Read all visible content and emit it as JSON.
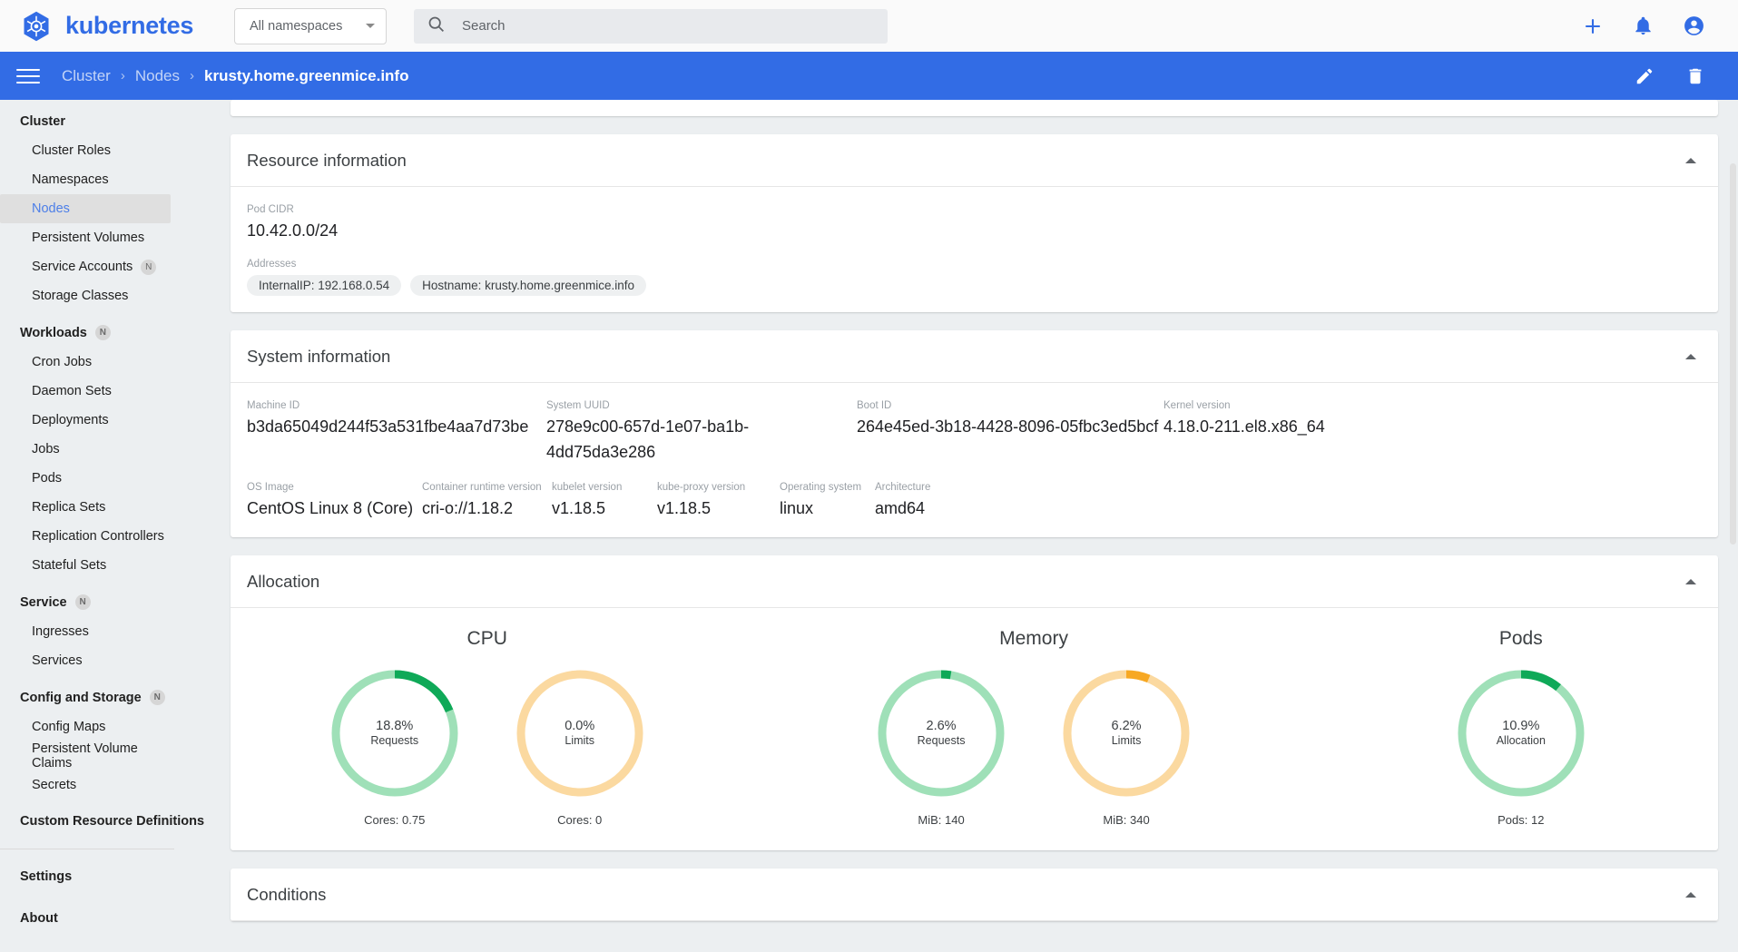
{
  "header": {
    "brand": "kubernetes",
    "logo_icon": "kubernetes-helm-logo",
    "namespace_selector": {
      "value": "All namespaces",
      "icon": "chevron-down-icon"
    },
    "search": {
      "placeholder": "Search",
      "value": "",
      "icon": "search-icon"
    },
    "actions": [
      {
        "name": "create-button",
        "icon": "plus-icon"
      },
      {
        "name": "notifications-button",
        "icon": "bell-icon"
      },
      {
        "name": "account-button",
        "icon": "account-circle-icon"
      }
    ]
  },
  "breadcrumb_bar": {
    "menu_icon": "hamburger-menu-icon",
    "crumbs": [
      {
        "label": "Cluster",
        "active": false
      },
      {
        "label": "Nodes",
        "active": false
      },
      {
        "label": "krusty.home.greenmice.info",
        "active": true
      }
    ],
    "separator": "›",
    "actions": [
      {
        "name": "edit-button",
        "icon": "pencil-icon"
      },
      {
        "name": "delete-button",
        "icon": "trash-icon"
      }
    ]
  },
  "sidebar": {
    "groups": [
      {
        "title": "Cluster",
        "badge": null,
        "items": [
          {
            "label": "Cluster Roles",
            "badge": null,
            "selected": false
          },
          {
            "label": "Namespaces",
            "badge": null,
            "selected": false
          },
          {
            "label": "Nodes",
            "badge": null,
            "selected": true
          },
          {
            "label": "Persistent Volumes",
            "badge": null,
            "selected": false
          },
          {
            "label": "Service Accounts",
            "badge": "N",
            "selected": false
          },
          {
            "label": "Storage Classes",
            "badge": null,
            "selected": false
          }
        ]
      },
      {
        "title": "Workloads",
        "badge": "N",
        "items": [
          {
            "label": "Cron Jobs",
            "badge": null,
            "selected": false
          },
          {
            "label": "Daemon Sets",
            "badge": null,
            "selected": false
          },
          {
            "label": "Deployments",
            "badge": null,
            "selected": false
          },
          {
            "label": "Jobs",
            "badge": null,
            "selected": false
          },
          {
            "label": "Pods",
            "badge": null,
            "selected": false
          },
          {
            "label": "Replica Sets",
            "badge": null,
            "selected": false
          },
          {
            "label": "Replication Controllers",
            "badge": null,
            "selected": false
          },
          {
            "label": "Stateful Sets",
            "badge": null,
            "selected": false
          }
        ]
      },
      {
        "title": "Service",
        "badge": "N",
        "items": [
          {
            "label": "Ingresses",
            "badge": null,
            "selected": false
          },
          {
            "label": "Services",
            "badge": null,
            "selected": false
          }
        ]
      },
      {
        "title": "Config and Storage",
        "badge": "N",
        "items": [
          {
            "label": "Config Maps",
            "badge": null,
            "selected": false
          },
          {
            "label": "Persistent Volume Claims",
            "badge": null,
            "selected": false
          },
          {
            "label": "Secrets",
            "badge": null,
            "selected": false
          }
        ]
      },
      {
        "title": "Custom Resource Definitions",
        "badge": null,
        "items": []
      }
    ],
    "footer": [
      {
        "label": "Settings"
      },
      {
        "label": "About"
      }
    ]
  },
  "main": {
    "resource_information": {
      "title": "Resource information",
      "collapse_icon": "chevron-up-icon",
      "pod_cidr": {
        "label": "Pod CIDR",
        "value": "10.42.0.0/24"
      },
      "addresses": {
        "label": "Addresses",
        "chips": [
          "InternalIP: 192.168.0.54",
          "Hostname: krusty.home.greenmice.info"
        ]
      }
    },
    "system_information": {
      "title": "System information",
      "collapse_icon": "chevron-up-icon",
      "row1": [
        {
          "label": "Machine ID",
          "value": "b3da65049d244f53a531fbe4aa7d73be"
        },
        {
          "label": "System UUID",
          "value": "278e9c00-657d-1e07-ba1b-4dd75da3e286"
        },
        {
          "label": "Boot ID",
          "value": "264e45ed-3b18-4428-8096-05fbc3ed5bcf"
        },
        {
          "label": "Kernel version",
          "value": "4.18.0-211.el8.x86_64"
        }
      ],
      "row2": [
        {
          "label": "OS Image",
          "value": "CentOS Linux 8 (Core)"
        },
        {
          "label": "Container runtime version",
          "value": "cri-o://1.18.2"
        },
        {
          "label": "kubelet version",
          "value": "v1.18.5"
        },
        {
          "label": "kube-proxy version",
          "value": "v1.18.5"
        },
        {
          "label": "Operating system",
          "value": "linux"
        },
        {
          "label": "Architecture",
          "value": "amd64"
        }
      ]
    },
    "allocation": {
      "title": "Allocation",
      "collapse_icon": "chevron-up-icon"
    },
    "conditions": {
      "title": "Conditions",
      "collapse_icon": "chevron-up-icon"
    }
  },
  "chart_data": {
    "type": "pie",
    "title": "Allocation",
    "groups": [
      {
        "name": "CPU",
        "donuts": [
          {
            "percent": 18.8,
            "percent_label": "18.8%",
            "sublabel": "Requests",
            "footer": "Cores: 0.75",
            "arc_color": "#0fa958",
            "track_color": "#9fe0b8"
          },
          {
            "percent": 0.0,
            "percent_label": "0.0%",
            "sublabel": "Limits",
            "footer": "Cores: 0",
            "arc_color": "#f7a823",
            "track_color": "#fbd9a0"
          }
        ]
      },
      {
        "name": "Memory",
        "donuts": [
          {
            "percent": 2.6,
            "percent_label": "2.6%",
            "sublabel": "Requests",
            "footer": "MiB: 140",
            "arc_color": "#0fa958",
            "track_color": "#9fe0b8"
          },
          {
            "percent": 6.2,
            "percent_label": "6.2%",
            "sublabel": "Limits",
            "footer": "MiB: 340",
            "arc_color": "#f7a823",
            "track_color": "#fbd9a0"
          }
        ]
      },
      {
        "name": "Pods",
        "donuts": [
          {
            "percent": 10.9,
            "percent_label": "10.9%",
            "sublabel": "Allocation",
            "footer": "Pods: 12",
            "arc_color": "#0fa958",
            "track_color": "#9fe0b8"
          }
        ]
      }
    ]
  }
}
